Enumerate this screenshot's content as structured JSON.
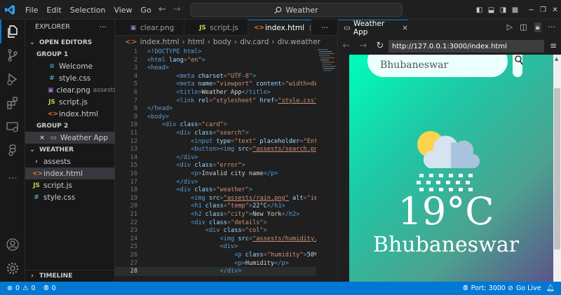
{
  "menu": [
    "File",
    "Edit",
    "Selection",
    "View",
    "Go"
  ],
  "search": {
    "label": "Weather"
  },
  "explorer": {
    "title": "EXPLORER",
    "more": "···",
    "open_editors": "OPEN EDITORS",
    "group1": "GROUP 1",
    "group1_items": [
      {
        "icon": "≡",
        "label": "Welcome",
        "hint": ""
      },
      {
        "icon": "#",
        "label": "style.css",
        "hint": ""
      },
      {
        "icon": "▣",
        "label": "clear.png",
        "hint": "assests"
      },
      {
        "icon": "JS",
        "label": "script.js",
        "hint": ""
      },
      {
        "icon": "<>",
        "label": "index.html",
        "hint": ""
      }
    ],
    "group2": "GROUP 2",
    "group2_item": "Weather App",
    "project": "WEATHER",
    "project_items": [
      {
        "icon": "›",
        "label": "assests"
      },
      {
        "icon": "<>",
        "label": "index.html"
      },
      {
        "icon": "JS",
        "label": "script.js"
      },
      {
        "icon": "#",
        "label": "style.css"
      }
    ],
    "timeline": "TIMELINE"
  },
  "tabs": [
    {
      "icon": "▣",
      "label": "clear.png"
    },
    {
      "icon": "JS",
      "label": "script.js"
    },
    {
      "icon": "<>",
      "label": "index.html",
      "close": "×"
    }
  ],
  "tab_more": "···",
  "breadcrumb": [
    "index.html",
    "›",
    "html",
    "›",
    "body",
    "›",
    "div.card",
    "›",
    "div.weather"
  ],
  "code": {
    "lines": [
      [
        [
          "t",
          "<!DOCTYPE html>"
        ]
      ],
      [
        [
          "t",
          "<html"
        ],
        [
          "a",
          " lang"
        ],
        [
          "p",
          "="
        ],
        [
          "s",
          "\"en\""
        ],
        [
          "t",
          ">"
        ]
      ],
      [
        [
          "t",
          "<head>"
        ]
      ],
      [
        [
          "x",
          "        "
        ],
        [
          "t",
          "<meta"
        ],
        [
          "a",
          " charset"
        ],
        [
          "p",
          "="
        ],
        [
          "s",
          "\"UTF-8\""
        ],
        [
          "t",
          ">"
        ]
      ],
      [
        [
          "x",
          "        "
        ],
        [
          "t",
          "<meta"
        ],
        [
          "a",
          " name"
        ],
        [
          "p",
          "="
        ],
        [
          "s",
          "\"viewport\""
        ],
        [
          "a",
          " content"
        ],
        [
          "p",
          "="
        ],
        [
          "s",
          "\"width=devic"
        ]
      ],
      [
        [
          "x",
          "        "
        ],
        [
          "t",
          "<title>"
        ],
        [
          "x",
          "Weather App"
        ],
        [
          "t",
          "</title>"
        ]
      ],
      [
        [
          "x",
          "        "
        ],
        [
          "t",
          "<link"
        ],
        [
          "a",
          " rel"
        ],
        [
          "p",
          "="
        ],
        [
          "s",
          "\"stylesheet\""
        ],
        [
          "a",
          " href"
        ],
        [
          "p",
          "="
        ],
        [
          "su",
          "\"style.css\""
        ],
        [
          "t",
          ">"
        ]
      ],
      [
        [
          "t",
          "</head>"
        ]
      ],
      [
        [
          "t",
          "<body>"
        ]
      ],
      [
        [
          "x",
          "    "
        ],
        [
          "t",
          "<div"
        ],
        [
          "a",
          " class"
        ],
        [
          "p",
          "="
        ],
        [
          "s",
          "\"card\""
        ],
        [
          "t",
          ">"
        ]
      ],
      [
        [
          "x",
          "        "
        ],
        [
          "t",
          "<div"
        ],
        [
          "a",
          " class"
        ],
        [
          "p",
          "="
        ],
        [
          "s",
          "\"search\""
        ],
        [
          "t",
          ">"
        ]
      ],
      [
        [
          "x",
          "            "
        ],
        [
          "t",
          "<input"
        ],
        [
          "a",
          " type"
        ],
        [
          "p",
          "="
        ],
        [
          "s",
          "\"text\""
        ],
        [
          "a",
          " placeholder"
        ],
        [
          "p",
          "="
        ],
        [
          "s",
          "\"Enter"
        ]
      ],
      [
        [
          "x",
          "            "
        ],
        [
          "t",
          "<button><img"
        ],
        [
          "a",
          " src"
        ],
        [
          "p",
          "="
        ],
        [
          "su",
          "\"assests/search.png\""
        ],
        [
          "t",
          ">"
        ]
      ],
      [
        [
          "x",
          "        "
        ],
        [
          "t",
          "</div>"
        ]
      ],
      [
        [
          "x",
          "        "
        ],
        [
          "t",
          "<div"
        ],
        [
          "a",
          " class"
        ],
        [
          "p",
          "="
        ],
        [
          "s",
          "\"error\""
        ],
        [
          "t",
          ">"
        ]
      ],
      [
        [
          "x",
          "            "
        ],
        [
          "t",
          "<p>"
        ],
        [
          "x",
          "Invalid city name"
        ],
        [
          "t",
          "</p>"
        ]
      ],
      [
        [
          "x",
          "        "
        ],
        [
          "t",
          "</div>"
        ]
      ],
      [
        [
          "x",
          "        "
        ],
        [
          "t",
          "<div"
        ],
        [
          "a",
          " class"
        ],
        [
          "p",
          "="
        ],
        [
          "s",
          "\"weather\""
        ],
        [
          "t",
          ">"
        ]
      ],
      [
        [
          "x",
          "            "
        ],
        [
          "t",
          "<img"
        ],
        [
          "a",
          " src"
        ],
        [
          "p",
          "="
        ],
        [
          "su",
          "\"assests/rain.png\""
        ],
        [
          "a",
          " alt"
        ],
        [
          "p",
          "="
        ],
        [
          "s",
          "\"image"
        ]
      ],
      [
        [
          "x",
          "            "
        ],
        [
          "t",
          "<h1"
        ],
        [
          "a",
          " class"
        ],
        [
          "p",
          "="
        ],
        [
          "s",
          "\"temp\""
        ],
        [
          "t",
          ">"
        ],
        [
          "x",
          "22°C"
        ],
        [
          "t",
          "</h1>"
        ]
      ],
      [
        [
          "x",
          "            "
        ],
        [
          "t",
          "<h2"
        ],
        [
          "a",
          " class"
        ],
        [
          "p",
          "="
        ],
        [
          "s",
          "\"city\""
        ],
        [
          "t",
          ">"
        ],
        [
          "x",
          "New York"
        ],
        [
          "t",
          "</h2>"
        ]
      ],
      [
        [
          "x",
          "            "
        ],
        [
          "t",
          "<div"
        ],
        [
          "a",
          " class"
        ],
        [
          "p",
          "="
        ],
        [
          "s",
          "\"details\""
        ],
        [
          "t",
          ">"
        ]
      ],
      [
        [
          "x",
          "                "
        ],
        [
          "t",
          "<div"
        ],
        [
          "a",
          " class"
        ],
        [
          "p",
          "="
        ],
        [
          "s",
          "\"col\""
        ],
        [
          "t",
          ">"
        ]
      ],
      [
        [
          "x",
          "                    "
        ],
        [
          "t",
          "<img"
        ],
        [
          "a",
          " src"
        ],
        [
          "p",
          "="
        ],
        [
          "su",
          "\"assests/humidity.p"
        ]
      ],
      [
        [
          "x",
          "                    "
        ],
        [
          "t",
          "<div>"
        ]
      ],
      [
        [
          "x",
          "                        "
        ],
        [
          "t",
          "<p"
        ],
        [
          "a",
          " class"
        ],
        [
          "p",
          "="
        ],
        [
          "s",
          "\"humidity\""
        ],
        [
          "t",
          ">"
        ],
        [
          "x",
          "50%"
        ]
      ],
      [
        [
          "x",
          "                        "
        ],
        [
          "t",
          "<p>"
        ],
        [
          "x",
          "Humidity"
        ],
        [
          "t",
          "</p>"
        ]
      ],
      [
        [
          "x",
          "                    "
        ],
        [
          "t",
          "</div>"
        ]
      ]
    ]
  },
  "browser": {
    "tab": "Weather App",
    "close": "×",
    "url": "http://127.0.0.1:3000/index.html",
    "page": {
      "search_value": "Bhubaneswar",
      "temp": "19°C",
      "city": "Bhubaneswar"
    }
  },
  "status": {
    "errors": "0",
    "warnings": "0",
    "ports": "0",
    "port": "Port: 3000",
    "golive": "Go Live"
  },
  "colors": {
    "accent": "#0078d4",
    "status_bg": "#0078d4",
    "gradient_start": "#00feba",
    "gradient_end": "#5b548a"
  }
}
